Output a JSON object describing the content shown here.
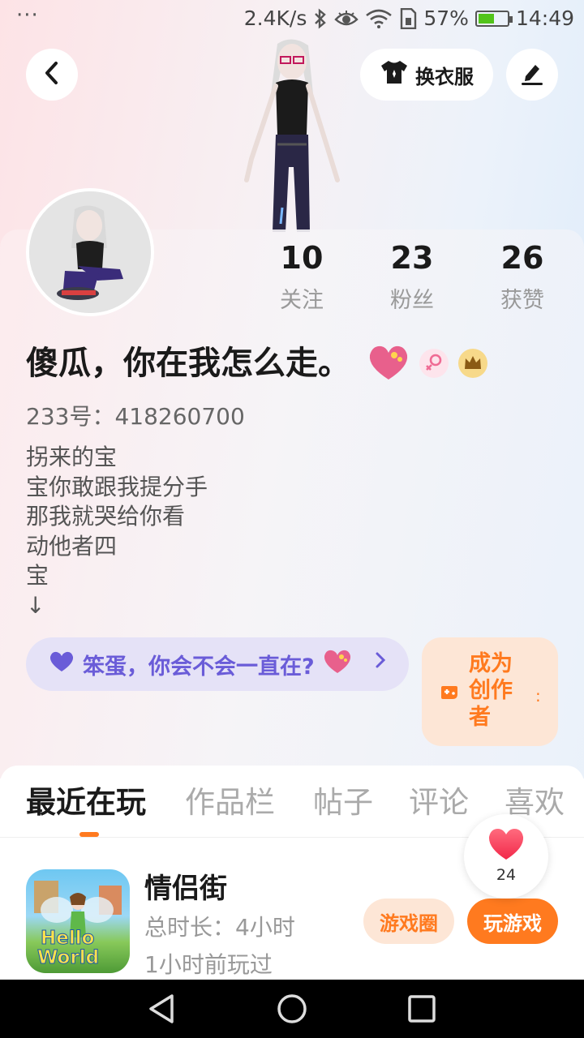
{
  "status_bar": {
    "menu_dots": "···",
    "network_speed": "2.4K/s",
    "battery_percent": "57%",
    "time": "14:49",
    "battery_level": 0.57,
    "icons": [
      "bluetooth-icon",
      "eye-icon",
      "wifi-icon",
      "sim-icon",
      "battery-icon"
    ]
  },
  "header": {
    "outfit_label": "换衣服"
  },
  "stats": [
    {
      "value": "10",
      "label": "关注"
    },
    {
      "value": "23",
      "label": "粉丝"
    },
    {
      "value": "26",
      "label": "获赞"
    }
  ],
  "profile": {
    "nickname": "傻瓜，你在我怎么走。",
    "uid": "233号：418260700",
    "bio": "拐来的宝\n宝你敢跟我提分手\n那我就哭给你看\n动他者四\n宝\n↓",
    "badges": [
      "heart-badge-icon",
      "female-icon",
      "crown-icon"
    ]
  },
  "status_pill": {
    "text": "笨蛋，你会不会一直在?"
  },
  "creator_card": {
    "text": "成为创作者"
  },
  "tabs": [
    "最近在玩",
    "作品栏",
    "帖子",
    "评论",
    "喜欢"
  ],
  "active_tab": 0,
  "recent_game": {
    "title": "情侣街",
    "duration": "总时长：4小时",
    "last_played": "1小时前玩过",
    "icon_text_1": "Hello",
    "icon_text_2": "World",
    "circle_button": "游戏圈",
    "play_button": "玩游戏"
  },
  "like_fab": {
    "count": "24"
  },
  "colors": {
    "accent": "#ff7a1f",
    "pill_text": "#6a5cd8",
    "pill_bg": "#e5e2f7",
    "creator_bg": "#fde6d6"
  }
}
